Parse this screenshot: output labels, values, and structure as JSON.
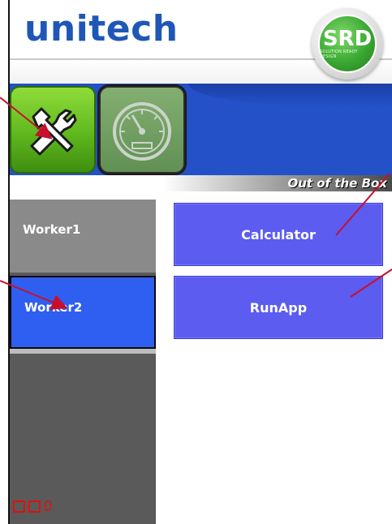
{
  "header": {
    "brand": "unitech",
    "logo_text": "SRD",
    "logo_subtext": "SOLUTION READY DESIGN"
  },
  "toolbar": {
    "apps": [
      {
        "icon": "tools-icon",
        "active": true
      },
      {
        "icon": "gauge-icon",
        "active": false
      }
    ],
    "caption": "Out of the Box"
  },
  "workers": [
    {
      "label": "Worker1",
      "selected": false
    },
    {
      "label": "Worker2",
      "selected": true
    }
  ],
  "actions": [
    {
      "label": "Calculator"
    },
    {
      "label": "RunApp"
    }
  ],
  "status": {
    "count": "0"
  },
  "colors": {
    "brand_blue": "#1f57b8",
    "band_blue": "#2450c8",
    "action_blue": "#5c5cf0",
    "selected_worker": "#2f5ff0",
    "annotation_red": "#c8102e",
    "status_red": "#e01010"
  }
}
